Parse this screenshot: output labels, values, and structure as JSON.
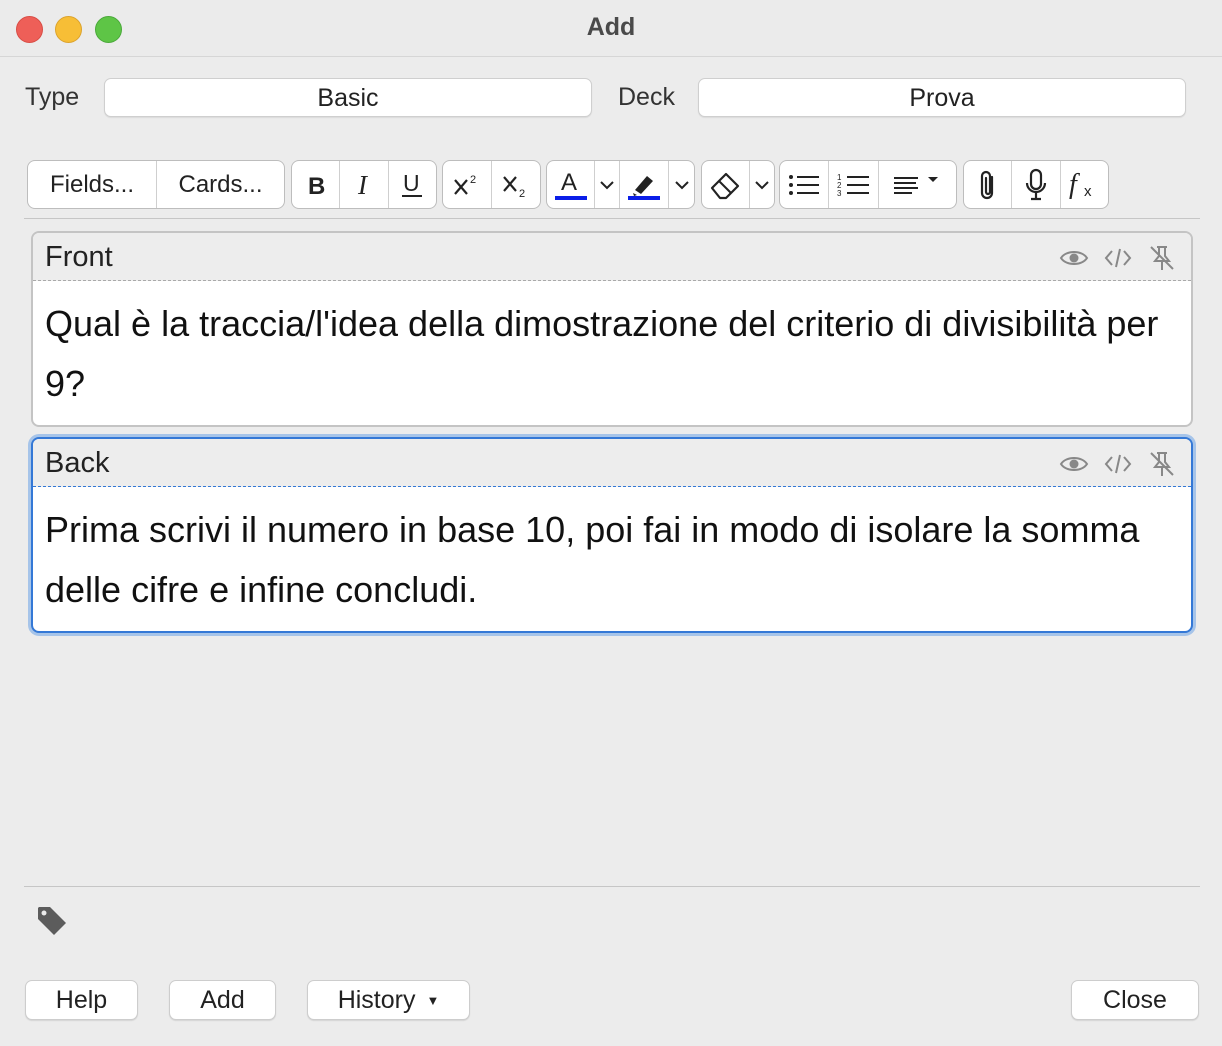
{
  "window": {
    "title": "Add"
  },
  "selectors": {
    "type_label": "Type",
    "type_value": "Basic",
    "deck_label": "Deck",
    "deck_value": "Prova"
  },
  "toolbar": {
    "fields_label": "Fields...",
    "cards_label": "Cards...",
    "text_color": "#0a1ee8",
    "highlight_color": "#0a1ee8"
  },
  "fields": [
    {
      "name": "Front",
      "content": "Qual è la traccia/l'idea della dimostrazione del criterio di divisibilità per 9?"
    },
    {
      "name": "Back",
      "content": "Prima scrivi il numero in base 10, poi fai in modo di isolare la somma delle cifre e infine concludi."
    }
  ],
  "buttons": {
    "help": "Help",
    "add": "Add",
    "history": "History",
    "close": "Close"
  },
  "colors": {
    "focus": "#3478d6"
  }
}
